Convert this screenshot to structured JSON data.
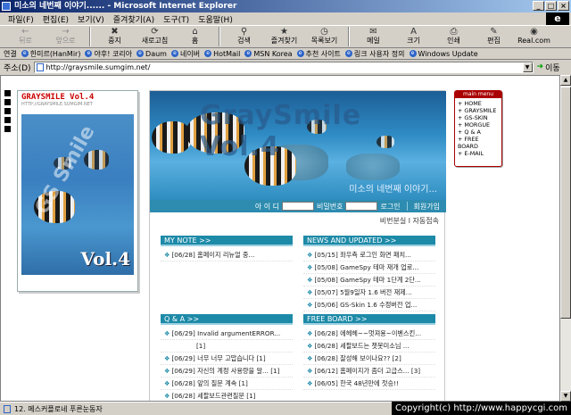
{
  "window": {
    "title": "미소의 네번째 이야기...... - Microsoft Internet Explorer"
  },
  "menu": [
    "파일(F)",
    "편집(E)",
    "보기(V)",
    "즐겨찾기(A)",
    "도구(T)",
    "도움말(H)"
  ],
  "toolbar": [
    {
      "label": "뒤로",
      "icon": "back-icon",
      "glyph": "←",
      "disabled": true
    },
    {
      "label": "앞으로",
      "icon": "forward-icon",
      "glyph": "→",
      "disabled": true
    },
    {
      "label": "중지",
      "icon": "stop-icon",
      "glyph": "✖",
      "disabled": false
    },
    {
      "label": "새로고침",
      "icon": "refresh-icon",
      "glyph": "⟳",
      "disabled": false
    },
    {
      "label": "홈",
      "icon": "home-icon",
      "glyph": "⌂",
      "disabled": false
    },
    {
      "label": "검색",
      "icon": "search-icon",
      "glyph": "⚲",
      "disabled": false
    },
    {
      "label": "즐겨찾기",
      "icon": "favorites-icon",
      "glyph": "★",
      "disabled": false
    },
    {
      "label": "목록보기",
      "icon": "history-icon",
      "glyph": "◷",
      "disabled": false
    },
    {
      "label": "메일",
      "icon": "mail-icon",
      "glyph": "✉",
      "disabled": false
    },
    {
      "label": "크기",
      "icon": "font-size-icon",
      "glyph": "A",
      "disabled": false
    },
    {
      "label": "인쇄",
      "icon": "print-icon",
      "glyph": "⎙",
      "disabled": false
    },
    {
      "label": "편집",
      "icon": "edit-icon",
      "glyph": "✎",
      "disabled": false
    },
    {
      "label": "Real.com",
      "icon": "realplayer-icon",
      "glyph": "◉",
      "disabled": false
    }
  ],
  "links": {
    "label": "연결",
    "items": [
      "한미르(HanMir)",
      "야후! 코리아",
      "Daum",
      "네이버",
      "HotMail",
      "MSN Korea",
      "추천 사이트",
      "링크 사용자 정의",
      "Windows Update"
    ]
  },
  "address": {
    "label": "주소(D)",
    "url": "http://graysmile.sumgim.net/",
    "go": "이동"
  },
  "card": {
    "title": "GRAYSMILE Vol.4",
    "url": "HTTP://GRAYSMILE.SUMGIM.NET",
    "image_text": "GS Smile",
    "vol": "Vol.4"
  },
  "banner": {
    "title": "GraySmile Vol.4",
    "subtitle": "미소의 네번째 이야기..."
  },
  "login": {
    "id_label": "아 이 디",
    "pw_label": "비밀번호",
    "login": "로그인",
    "join": "회원가입"
  },
  "site_links": "비번분실 l 자동접속",
  "sections": {
    "mynote": {
      "title": "MY NOTE >>",
      "items": [
        {
          "date": "[06/28]",
          "text": "홈페이지 리뉴얼 중..."
        }
      ]
    },
    "news": {
      "title": "NEWS AND UPDATED >>",
      "items": [
        {
          "date": "[05/15]",
          "text": "좌우측 로그인 화면 패치..."
        },
        {
          "date": "[05/08]",
          "text": "GameSpy 테마 재개 업로..."
        },
        {
          "date": "[05/08]",
          "text": "GameSpy 테마 1단계 2단..."
        },
        {
          "date": "[05/07]",
          "text": "5월9일자 1.6 버전 재제..."
        },
        {
          "date": "[05/06]",
          "text": "GS-Skin 1.6 수정버전 업..."
        }
      ]
    },
    "qna": {
      "title": "Q & A >>",
      "items": [
        {
          "date": "[06/29]",
          "text": "Invalid argumentERROR..."
        },
        {
          "date": "",
          "text": "[1]"
        },
        {
          "date": "[06/29]",
          "text": "너무 너무 고맙습니다 [1]"
        },
        {
          "date": "[06/29]",
          "text": "자신의 계정 사용량을 알... [1]"
        },
        {
          "date": "[06/28]",
          "text": "앞의 질문 계속 [1]"
        },
        {
          "date": "[06/28]",
          "text": "세팔보드관련질문 [1]"
        }
      ]
    },
    "free": {
      "title": "FREE BOARD >>",
      "items": [
        {
          "date": "[06/28]",
          "text": "에헤헤~~멋져용~이벤스킨..."
        },
        {
          "date": "[06/28]",
          "text": "세팔보드는 챗봇미소님 ..."
        },
        {
          "date": "[06/28]",
          "text": "잘성해 보이나요?? [2]"
        },
        {
          "date": "[06/12]",
          "text": "홈페이지가 좀더 고급스... [3]"
        },
        {
          "date": "[06/05]",
          "text": "한국 48년만에 첫승!!"
        }
      ]
    }
  },
  "minimenu": {
    "title": "main menu",
    "items": [
      "+ HOME",
      "+ GRAYSMILE",
      "+ GS-SKIN",
      "+ MORGUE",
      "+ Q & A",
      "+ FREE BOARD",
      "+ E-MAIL"
    ]
  },
  "status": {
    "text": "12. 메스커플로네 푸른눈동자",
    "copyright": "Copyright(c) http://www.happycgi.com"
  },
  "colors": {
    "accent": "#1d8aa8",
    "titlebar": "#0a246a",
    "menu_border": "#aa0000"
  }
}
